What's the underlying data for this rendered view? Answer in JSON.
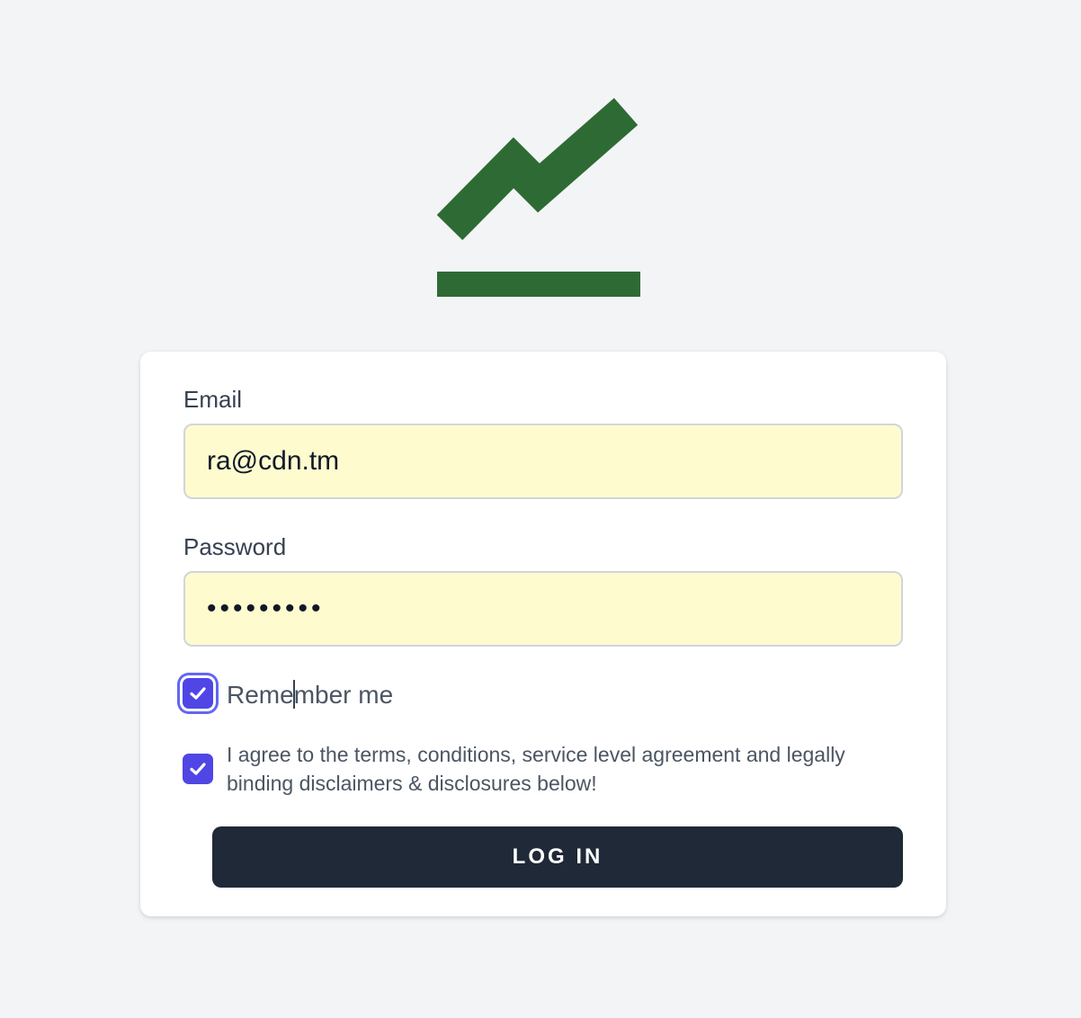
{
  "logo": {
    "icon": "trending-up-chart-icon",
    "color": "#2e6b34"
  },
  "form": {
    "email": {
      "label": "Email",
      "value": "ra@cdn.tm"
    },
    "password": {
      "label": "Password",
      "value": "•••••••••"
    },
    "remember": {
      "label_before_caret": "Reme",
      "label_after_caret": "mber me",
      "checked": true
    },
    "agree": {
      "label": "I agree to the terms, conditions, service level agreement and legally binding disclaimers & disclosures below!",
      "checked": true
    },
    "submit_label": "LOG IN"
  },
  "colors": {
    "background": "#f3f4f6",
    "input_fill": "#fefccf",
    "checkbox": "#4f46e5",
    "button": "#1f2937"
  }
}
